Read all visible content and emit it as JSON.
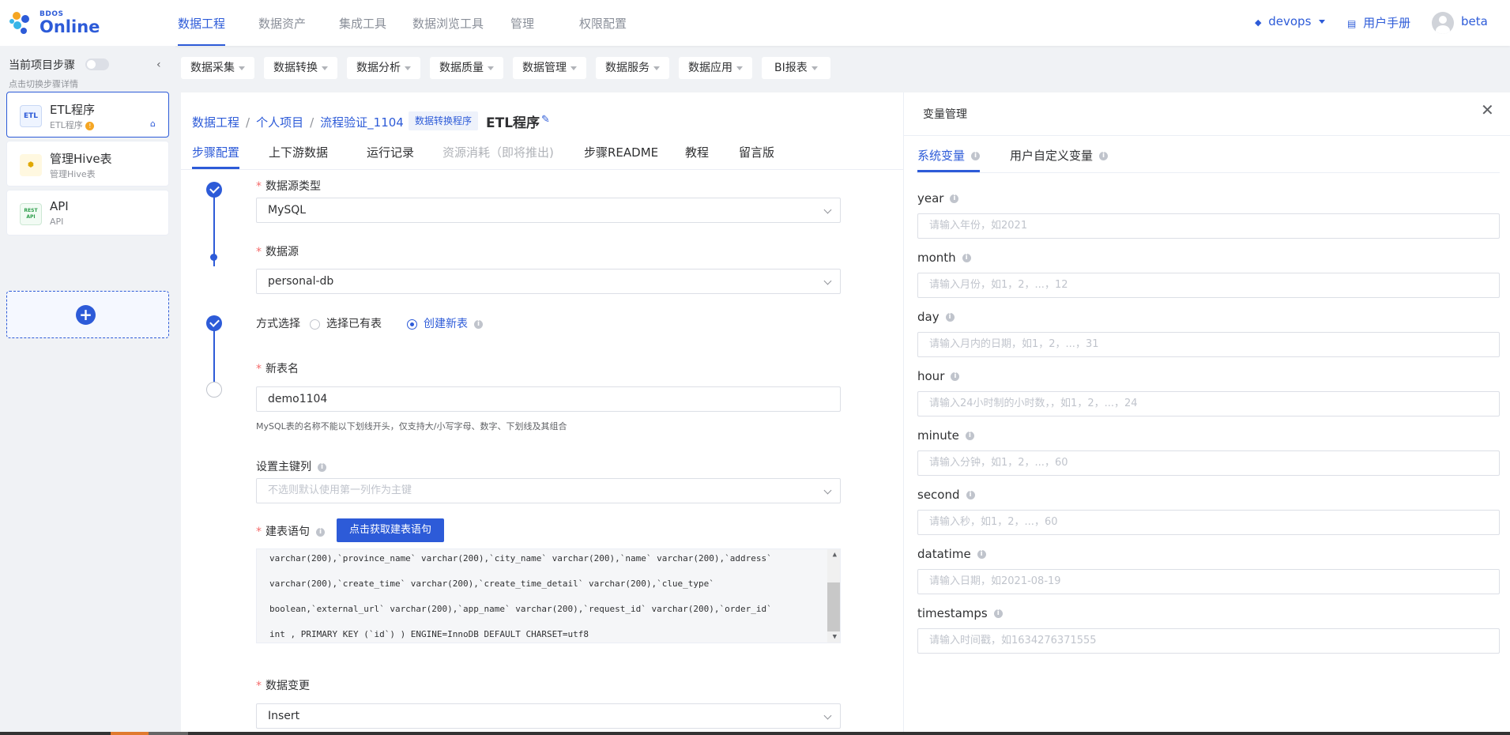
{
  "brand": {
    "small": "BDOS",
    "big": "Online"
  },
  "topnav": {
    "items": [
      "数据工程",
      "数据资产",
      "集成工具",
      "数据浏览工具",
      "管理",
      "权限配置"
    ],
    "workspace": "devops",
    "manual": "用户手册",
    "user": "beta"
  },
  "sidebar": {
    "title": "当前项目步骤",
    "subtitle": "点击切换步骤详情",
    "steps": [
      {
        "name": "ETL程序",
        "sub": "ETL程序",
        "icon": "ETL"
      },
      {
        "name": "管理Hive表",
        "sub": "管理Hive表",
        "icon": "hive"
      },
      {
        "name": "API",
        "sub": "API",
        "icon": "REST API"
      }
    ]
  },
  "categories": [
    "数据采集",
    "数据转换",
    "数据分析",
    "数据质量",
    "数据管理",
    "数据服务",
    "数据应用",
    "BI报表"
  ],
  "main": {
    "breadcrumb": [
      "数据工程",
      "个人项目",
      "流程验证_1104"
    ],
    "tag": "数据转换程序",
    "title": "ETL程序",
    "tabs": [
      "步骤配置",
      "上下游数据",
      "运行记录",
      "资源消耗（即将推出)",
      "步骤README",
      "教程",
      "留言版"
    ],
    "form": {
      "datasource_type_label": "数据源类型",
      "datasource_type_value": "MySQL",
      "datasource_label": "数据源",
      "datasource_value": "personal-db",
      "mode_label": "方式选择",
      "mode_option1": "选择已有表",
      "mode_option2": "创建新表",
      "newtable_label": "新表名",
      "newtable_value": "demo1104",
      "newtable_hint": "MySQL表的名称不能以下划线开头，仅支持大/小写字母、数字、下划线及其组合",
      "pk_label": "设置主键列",
      "pk_placeholder": "不选则默认使用第一列作为主键",
      "ddl_label": "建表语句",
      "ddl_button": "点击获取建表语句",
      "ddl_lines": [
        "varchar(200),`province_name` varchar(200),`city_name` varchar(200),`name` varchar(200),`address`",
        "varchar(200),`create_time` varchar(200),`create_time_detail` varchar(200),`clue_type`",
        "boolean,`external_url` varchar(200),`app_name` varchar(200),`request_id` varchar(200),`order_id`",
        "int , PRIMARY KEY (`id`) ) ENGINE=InnoDB DEFAULT CHARSET=utf8"
      ],
      "change_label": "数据变更",
      "change_value": "Insert"
    }
  },
  "varpanel": {
    "title": "变量管理",
    "tabs": [
      "系统变量",
      "用户自定义变量"
    ],
    "vars": [
      {
        "name": "year",
        "placeholder": "请输入年份，如2021"
      },
      {
        "name": "month",
        "placeholder": "请输入月份，如1，2，...，12"
      },
      {
        "name": "day",
        "placeholder": "请输入月内的日期，如1，2，...，31"
      },
      {
        "name": "hour",
        "placeholder": "请输入24小时制的小时数，，如1，2，...，24"
      },
      {
        "name": "minute",
        "placeholder": "请输入分钟，如1，2，...，60"
      },
      {
        "name": "second",
        "placeholder": "请输入秒，如1，2，...，60"
      },
      {
        "name": "datatime",
        "placeholder": "请输入日期，如2021-08-19"
      },
      {
        "name": "timestamps",
        "placeholder": "请输入时间戳，如1634276371555"
      }
    ]
  },
  "colors": {
    "accent": "#2d5bd8",
    "required": "#f56c6c"
  }
}
